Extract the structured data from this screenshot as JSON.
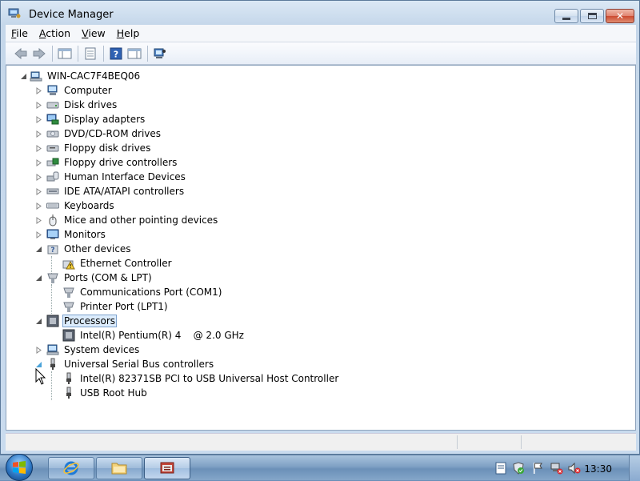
{
  "window": {
    "title": "Device Manager"
  },
  "menu": [
    {
      "prefix": "",
      "accel": "F",
      "rest": "ile"
    },
    {
      "prefix": "",
      "accel": "A",
      "rest": "ction"
    },
    {
      "prefix": "",
      "accel": "V",
      "rest": "iew"
    },
    {
      "prefix": "",
      "accel": "H",
      "rest": "elp"
    }
  ],
  "tree": {
    "root": "WIN-CAC7F4BEQ06",
    "categories": [
      "Computer",
      "Disk drives",
      "Display adapters",
      "DVD/CD-ROM drives",
      "Floppy disk drives",
      "Floppy drive controllers",
      "Human Interface Devices",
      "IDE ATA/ATAPI controllers",
      "Keyboards",
      "Mice and other pointing devices",
      "Monitors",
      "Other devices",
      "Ports (COM & LPT)",
      "Processors",
      "System devices",
      "Universal Serial Bus controllers"
    ],
    "other_devices_children": [
      "Ethernet Controller"
    ],
    "ports_children": [
      "Communications Port (COM1)",
      "Printer Port (LPT1)"
    ],
    "processors_children": [
      "Intel(R) Pentium(R) 4    @ 2.0 GHz"
    ],
    "usb_children": [
      "Intel(R) 82371SB PCI to USB Universal Host Controller",
      "USB Root Hub"
    ],
    "selected": "Processors"
  },
  "taskbar": {
    "clock": "13:30"
  },
  "colors": {
    "selection": "#dcecfc",
    "selection_border": "#7da2ce",
    "window_frame": "#c5d7ea"
  }
}
